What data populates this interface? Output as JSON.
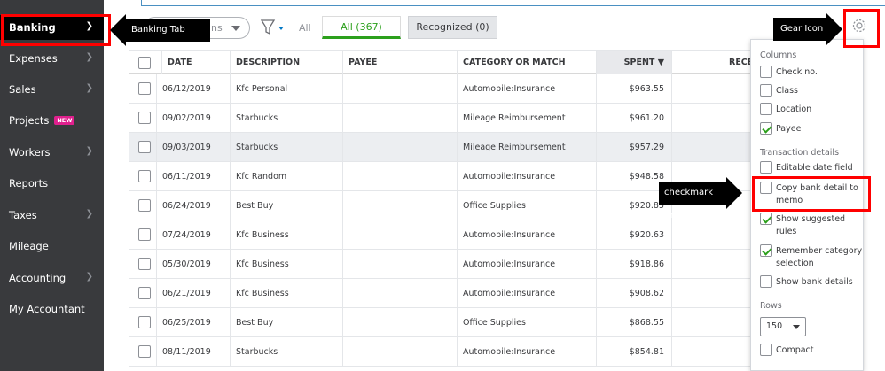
{
  "sidebar": {
    "items": [
      {
        "label": "Banking",
        "chevron": true,
        "active": true
      },
      {
        "label": "Expenses",
        "chevron": true
      },
      {
        "label": "Sales",
        "chevron": true
      },
      {
        "label": "Projects",
        "chevron": false,
        "badge": "NEW"
      },
      {
        "label": "Workers",
        "chevron": true
      },
      {
        "label": "Reports",
        "chevron": false
      },
      {
        "label": "Taxes",
        "chevron": true
      },
      {
        "label": "Mileage",
        "chevron": false
      },
      {
        "label": "Accounting",
        "chevron": true
      },
      {
        "label": "My Accountant",
        "chevron": false
      }
    ]
  },
  "toolbar": {
    "actions_text": "ns",
    "tab_all_plain": "All",
    "tab_all_active": "All (367)",
    "tab_recognized": "Recognized (0)"
  },
  "table": {
    "headers": {
      "date": "DATE",
      "description": "DESCRIPTION",
      "payee": "PAYEE",
      "category": "CATEGORY OR MATCH",
      "spent": "SPENT ▼",
      "received": "RECEI"
    },
    "rows": [
      {
        "date": "06/12/2019",
        "description": "Kfc Personal",
        "payee": "",
        "category": "Automobile:Insurance",
        "spent": "$963.55"
      },
      {
        "date": "09/02/2019",
        "description": "Starbucks",
        "payee": "",
        "category": "Mileage Reimbursement",
        "spent": "$961.20"
      },
      {
        "date": "09/03/2019",
        "description": "Starbucks",
        "payee": "",
        "category": "Mileage Reimbursement",
        "spent": "$957.29",
        "highlight": true
      },
      {
        "date": "06/11/2019",
        "description": "Kfc Random",
        "payee": "",
        "category": "Automobile:Insurance",
        "spent": "$948.58"
      },
      {
        "date": "06/24/2019",
        "description": "Best Buy",
        "payee": "",
        "category": "Office Supplies",
        "spent": "$920.85"
      },
      {
        "date": "07/24/2019",
        "description": "Kfc Business",
        "payee": "",
        "category": "Automobile:Insurance",
        "spent": "$920.63"
      },
      {
        "date": "05/30/2019",
        "description": "Kfc Business",
        "payee": "",
        "category": "Automobile:Insurance",
        "spent": "$918.86"
      },
      {
        "date": "06/21/2019",
        "description": "Kfc Business",
        "payee": "",
        "category": "Automobile:Insurance",
        "spent": "$908.62"
      },
      {
        "date": "06/25/2019",
        "description": "Best Buy",
        "payee": "",
        "category": "Office Supplies",
        "spent": "$868.55"
      },
      {
        "date": "08/11/2019",
        "description": "Starbucks",
        "payee": "",
        "category": "Automobile:Insurance",
        "spent": "$854.81"
      }
    ]
  },
  "settings_panel": {
    "columns_heading": "Columns",
    "columns": [
      {
        "label": "Check no.",
        "checked": false
      },
      {
        "label": "Class",
        "checked": false
      },
      {
        "label": "Location",
        "checked": false
      },
      {
        "label": "Payee",
        "checked": true
      }
    ],
    "transaction_heading": "Transaction details",
    "transaction_options": [
      {
        "label": "Editable date field",
        "checked": false
      },
      {
        "label": "Copy bank detail to memo",
        "checked": false
      },
      {
        "label": "Show suggested rules",
        "checked": true
      },
      {
        "label": "Remember category selection",
        "checked": true
      },
      {
        "label": "Show bank details",
        "checked": false
      }
    ],
    "rows_heading": "Rows",
    "rows_value": "150",
    "compact_label": "Compact",
    "compact_checked": false
  },
  "annotations": {
    "banking_tab": "Banking Tab",
    "gear_icon": "Gear Icon",
    "checkmark_this": "checkmark this"
  },
  "colors": {
    "sidebar_bg": "#393a3d",
    "accent_green": "#2ca01c",
    "annotation_red": "#ff0000"
  }
}
